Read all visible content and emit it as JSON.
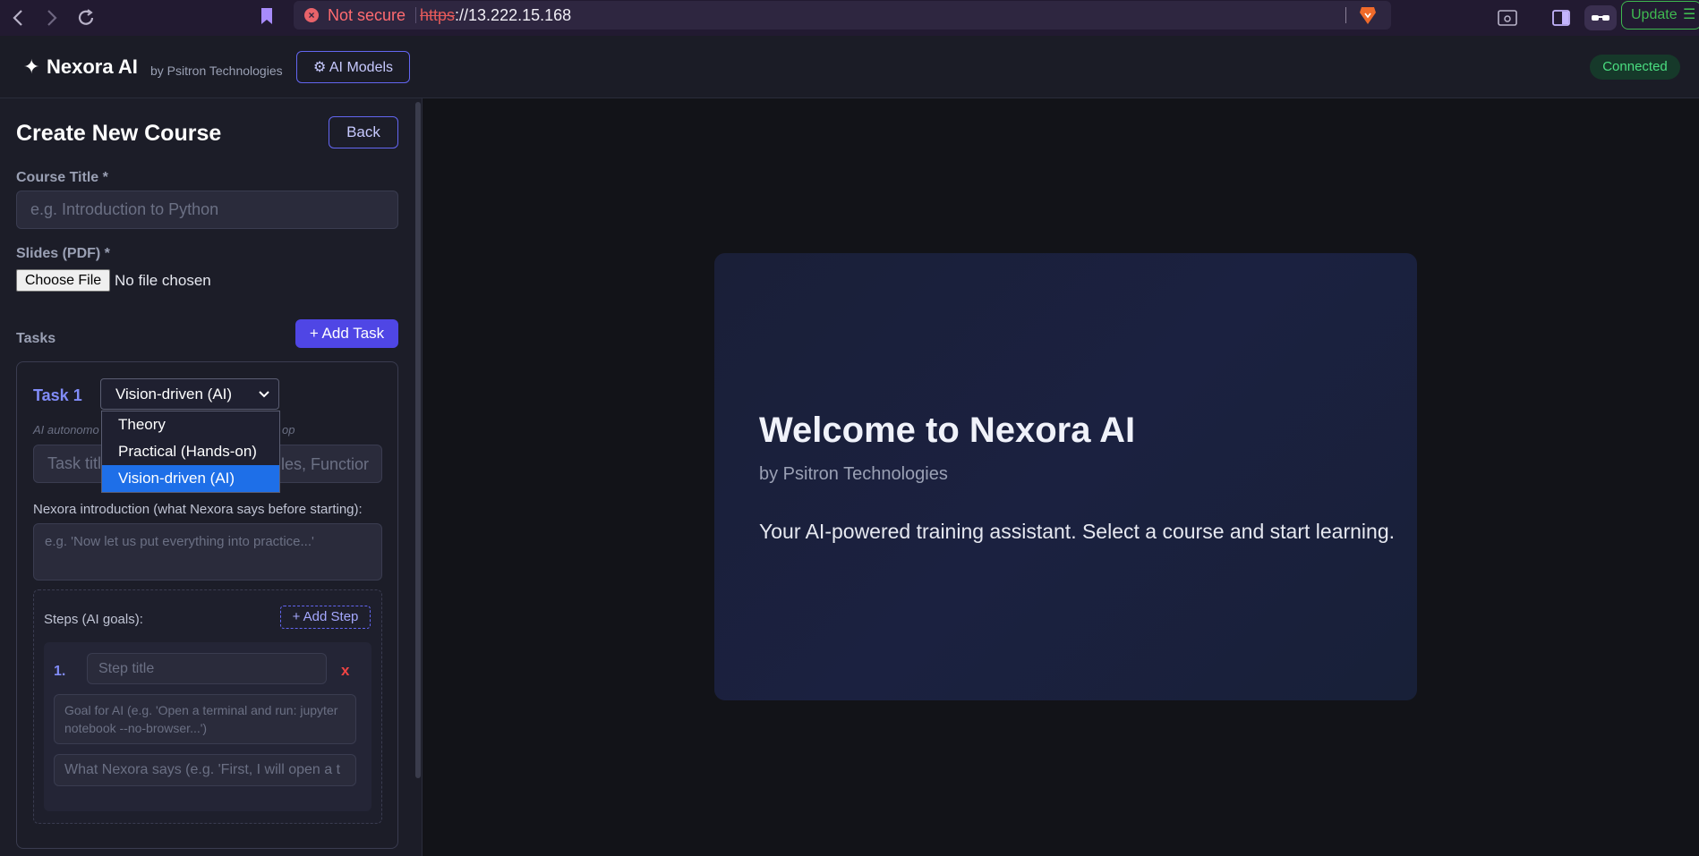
{
  "browser": {
    "security_label": "Not secure",
    "url_protocol": "https",
    "url_rest": "://13.222.15.168",
    "update_label": "Update"
  },
  "header": {
    "brand_star": "✦",
    "brand_name": "Nexora AI",
    "brand_by": "by Psitron Technologies",
    "models_label": "⚙ AI Models",
    "status": "Connected"
  },
  "form": {
    "title": "Create New Course",
    "back_label": "Back",
    "course_title_label": "Course Title *",
    "course_title_placeholder": "e.g. Introduction to Python",
    "slides_label": "Slides (PDF) *",
    "file_button": "Choose File",
    "file_status": "No file chosen",
    "tasks_label": "Tasks",
    "add_task_label": "+ Add Task",
    "task": {
      "title": "Task 1",
      "type_selected": "Vision-driven (AI)",
      "type_options": [
        "Theory",
        "Practical (Hands-on)",
        "Vision-driven (AI)"
      ],
      "hint_start": "AI autonomo",
      "hint_end": "op",
      "task_title_placeholder_start": "Task title",
      "task_title_placeholder_end": "les, Functior",
      "intro_label": "Nexora introduction (what Nexora says before starting):",
      "intro_placeholder": "e.g. 'Now let us put everything into practice...'",
      "steps_label": "Steps (AI goals):",
      "add_step_label": "+ Add Step",
      "steps": [
        {
          "number": "1.",
          "title_placeholder": "Step title",
          "remove_label": "x",
          "goal_placeholder": "Goal for AI (e.g. 'Open a terminal and run: jupyter notebook --no-browser...')",
          "say_placeholder": "What Nexora says (e.g. 'First, I will open a t"
        }
      ]
    }
  },
  "welcome": {
    "title": "Welcome to Nexora AI",
    "subtitle": "by Psitron Technologies",
    "text": "Your AI-powered training assistant. Select a course and start learning."
  }
}
